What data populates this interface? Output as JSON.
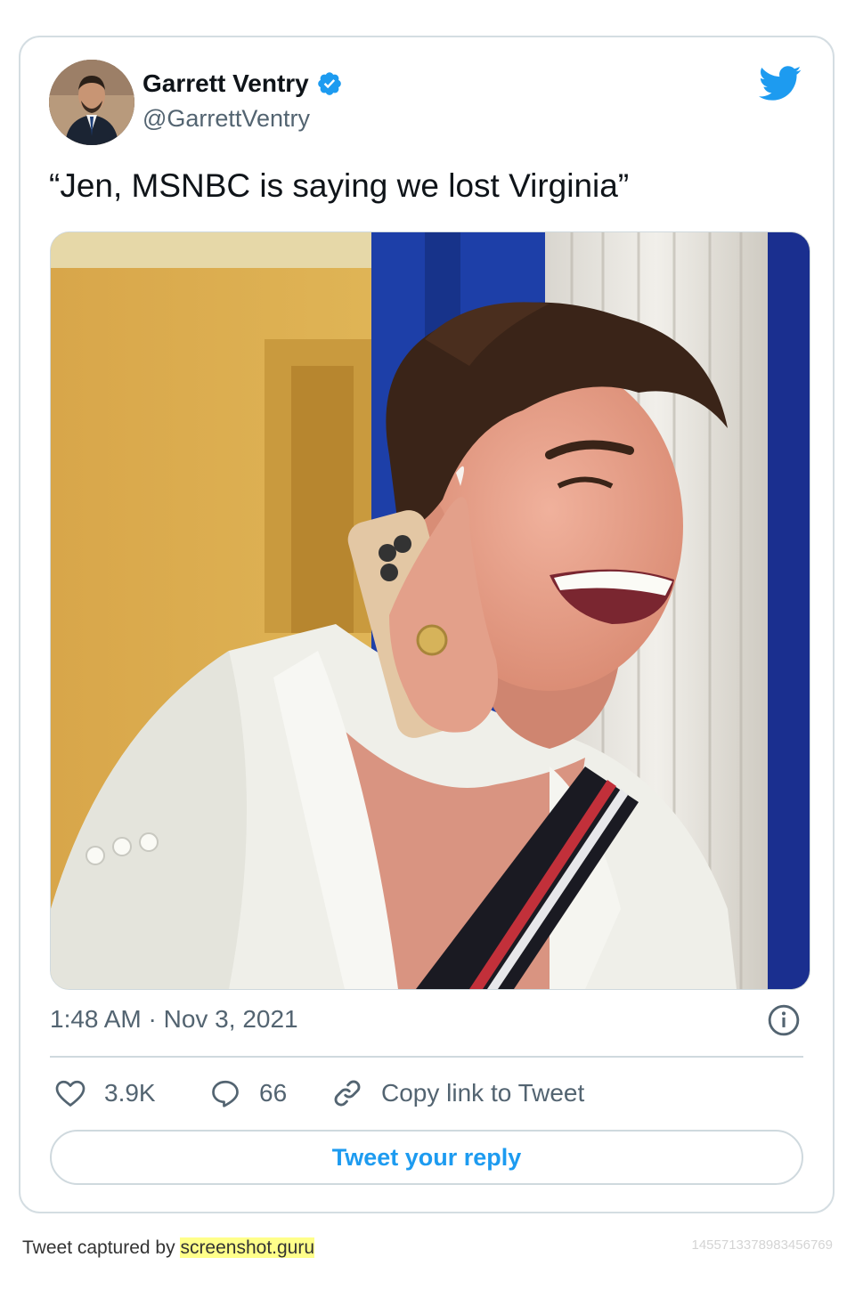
{
  "tweet": {
    "author_name": "Garrett Ventry",
    "author_handle": "@GarrettVentry",
    "text": "“Jen, MSNBC is saying we lost Virginia”",
    "timestamp": "1:48 AM · Nov 3, 2021",
    "likes": "3.9K",
    "replies": "66",
    "copy_link_label": "Copy link to Tweet",
    "reply_button_label": "Tweet your reply"
  },
  "footer": {
    "captured_prefix": "Tweet captured by ",
    "captured_site": "screenshot.guru",
    "tweet_id": "1455713378983456769"
  },
  "colors": {
    "twitter_blue": "#1d9bf0",
    "verified_blue": "#1d9bf0",
    "secondary_text": "#536471",
    "border": "#cfd9de",
    "highlight": "#ffff8a"
  },
  "icons": {
    "brand": "twitter-bird-icon",
    "verified": "verified-badge-icon",
    "info": "info-icon",
    "like": "heart-icon",
    "reply": "speech-bubble-icon",
    "copy": "link-icon"
  }
}
